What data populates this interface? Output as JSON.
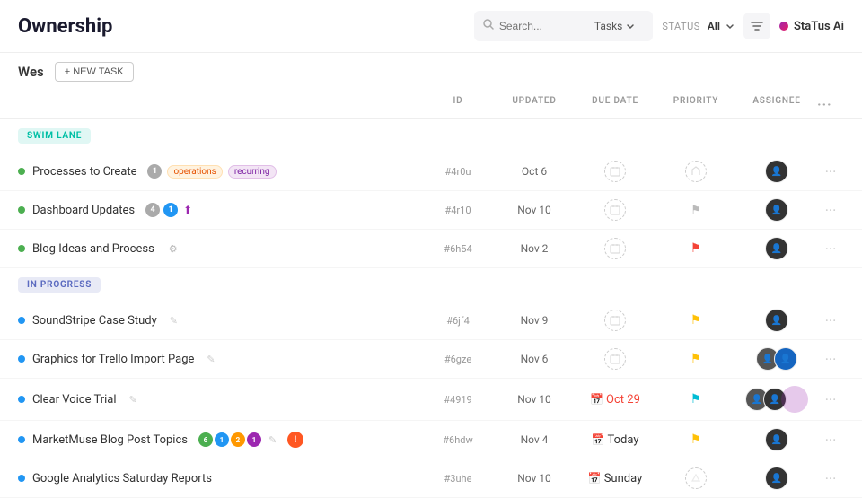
{
  "header": {
    "title": "Ownership",
    "search": {
      "placeholder": "Search...",
      "value": ""
    },
    "tasks_dropdown": "Tasks",
    "status_label": "STATUS",
    "status_value": "All",
    "filter_icon": "filter",
    "status_ai": "StaTus Ai"
  },
  "sub_header": {
    "username": "Wes",
    "new_task_label": "+ NEW TASK"
  },
  "table_columns": [
    "ID",
    "UPDATED",
    "DUE DATE",
    "PRIORITY",
    "ASSIGNEE",
    "..."
  ],
  "sections": [
    {
      "label": "SWIM LANE",
      "type": "swim",
      "tasks": [
        {
          "name": "Processes to Create",
          "dot_color": "green",
          "badge_count": "1",
          "tags": [
            "operations",
            "recurring"
          ],
          "id": "#4r0u",
          "updated": "Oct 6",
          "due_date": "",
          "due_overdue": false,
          "priority": "none",
          "assignee": "dark"
        },
        {
          "name": "Dashboard Updates",
          "dot_color": "green",
          "badge_count": "4",
          "badge_extra": "1",
          "tags": [],
          "id": "#4r10",
          "updated": "Nov 10",
          "due_date": "",
          "due_overdue": false,
          "priority": "none",
          "assignee": "dark"
        },
        {
          "name": "Blog Ideas and Process",
          "dot_color": "green",
          "badge_count": "",
          "tags": [],
          "id": "#6h54",
          "updated": "Nov 2",
          "due_date": "",
          "due_overdue": false,
          "priority": "red",
          "assignee": "dark"
        }
      ]
    },
    {
      "label": "IN PROGRESS",
      "type": "inprogress",
      "tasks": [
        {
          "name": "SoundStripe Case Study",
          "dot_color": "blue",
          "tags": [],
          "id": "#6jf4",
          "updated": "Nov 9",
          "due_date": "",
          "due_overdue": false,
          "priority": "yellow",
          "assignee": "dark"
        },
        {
          "name": "Graphics for Trello Import Page",
          "dot_color": "blue",
          "tags": [],
          "id": "#6gze",
          "updated": "Nov 6",
          "due_date": "",
          "due_overdue": false,
          "priority": "yellow",
          "assignee": "multi"
        },
        {
          "name": "Clear Voice Trial",
          "dot_color": "blue",
          "tags": [],
          "id": "#4919",
          "updated": "Nov 10",
          "due_date": "Oct 29",
          "due_overdue": true,
          "priority": "cyan",
          "assignee": "multi2"
        },
        {
          "name": "MarketMuse Blog Post Topics",
          "dot_color": "blue",
          "tags": [],
          "id": "#6hdw",
          "updated": "Nov 4",
          "due_date": "Today",
          "due_overdue": false,
          "priority": "yellow",
          "assignee": "dark"
        },
        {
          "name": "Google Analytics Saturday Reports",
          "dot_color": "blue",
          "tags": [],
          "id": "#3uhe",
          "updated": "Nov 10",
          "due_date": "Sunday",
          "due_overdue": false,
          "priority": "none_dashed",
          "assignee": "dark"
        }
      ]
    }
  ]
}
